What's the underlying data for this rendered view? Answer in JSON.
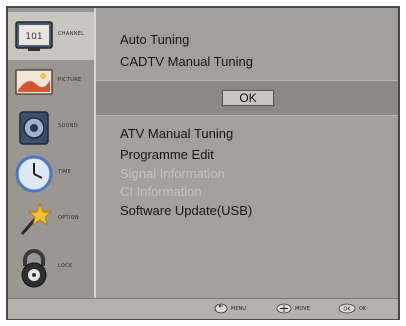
{
  "sidebar": {
    "items": [
      {
        "label": "CHANNEL",
        "icon": "tv-channel-icon"
      },
      {
        "label": "PICTURE",
        "icon": "picture-icon"
      },
      {
        "label": "SOUND",
        "icon": "speaker-icon"
      },
      {
        "label": "TIME",
        "icon": "clock-icon"
      },
      {
        "label": "OPTION",
        "icon": "star-wand-icon"
      },
      {
        "label": "LOCK",
        "icon": "padlock-icon"
      }
    ],
    "active_index": 0
  },
  "main": {
    "items": [
      {
        "label": "Auto Tuning",
        "enabled": true
      },
      {
        "label": "CADTV Manual Tuning",
        "enabled": true
      },
      {
        "label": "ATV Manual Tuning",
        "enabled": true
      },
      {
        "label": "Programme Edit",
        "enabled": true
      },
      {
        "label": "Signal Information",
        "enabled": false
      },
      {
        "label": "CI Information",
        "enabled": false
      },
      {
        "label": "Software Update(USB)",
        "enabled": true
      }
    ],
    "ok_label": "OK"
  },
  "footer": {
    "menu_label": "MENU",
    "move_label": "MOVE",
    "ok_label": "OK"
  },
  "colors": {
    "panel": "#a39f9a",
    "highlight_band": "#8c8984",
    "text": "#151515",
    "disabled_text": "#c7c4bf"
  }
}
